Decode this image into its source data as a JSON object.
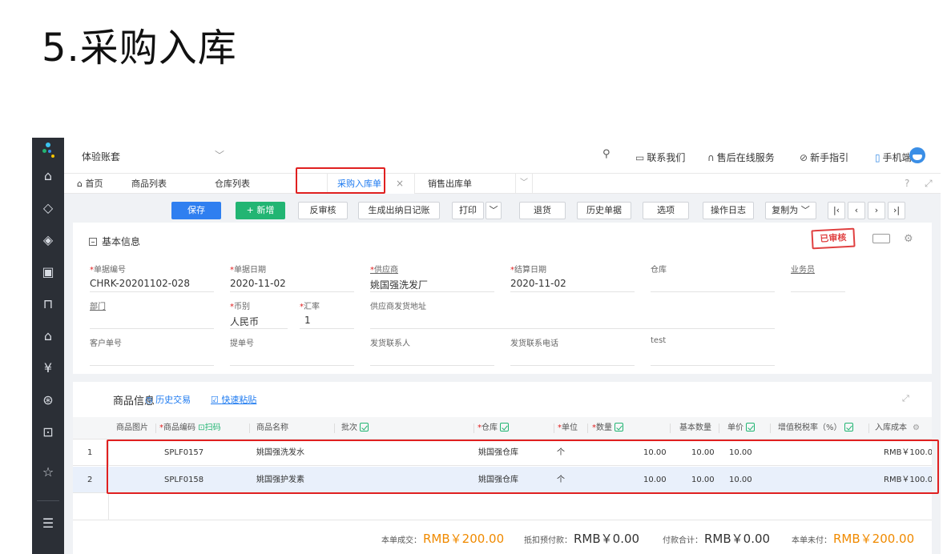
{
  "slide": {
    "title": "5.采购入库"
  },
  "topbar": {
    "account": "体验账套",
    "contact": "联系我们",
    "support": "售后在线服务",
    "guide": "新手指引",
    "mobile": "手机端"
  },
  "tabs": [
    {
      "label": "首页"
    },
    {
      "label": "商品列表"
    },
    {
      "label": "仓库列表"
    },
    {
      "label": "采购入库单",
      "active": true
    },
    {
      "label": "销售出库单"
    }
  ],
  "toolbar": {
    "save": "保存",
    "new": "+ 新增",
    "unaudit": "反审核",
    "journal": "生成出纳日记账",
    "print": "打印",
    "return": "退货",
    "history": "历史单据",
    "options": "选项",
    "oplog": "操作日志",
    "copy_as": "复制为"
  },
  "basic_info": {
    "title": "基本信息",
    "stamp": "已审核",
    "fields": {
      "doc_no": {
        "label": "单据编号",
        "value": "CHRK-20201102-028"
      },
      "doc_date": {
        "label": "单据日期",
        "value": "2020-11-02"
      },
      "supplier": {
        "label": "供应商",
        "value": "姚国强洗发厂"
      },
      "settle_date": {
        "label": "结算日期",
        "value": "2020-11-02"
      },
      "warehouse": {
        "label": "仓库",
        "value": ""
      },
      "salesman": {
        "label": "业务员",
        "value": ""
      },
      "dept": {
        "label": "部门",
        "value": ""
      },
      "currency": {
        "label": "币别",
        "value": "人民币"
      },
      "rate": {
        "label": "汇率",
        "value": "1"
      },
      "ship_addr": {
        "label": "供应商发货地址",
        "value": ""
      },
      "customer_no": {
        "label": "客户单号",
        "value": ""
      },
      "bill_no": {
        "label": "提单号",
        "value": ""
      },
      "ship_contact": {
        "label": "发货联系人",
        "value": ""
      },
      "ship_phone": {
        "label": "发货联系电话",
        "value": ""
      },
      "extra": {
        "label": "test",
        "value": ""
      }
    }
  },
  "products": {
    "title": "商品信息",
    "history_link": "历史交易",
    "paste_link": "快速粘贴",
    "headers": {
      "image": "商品图片",
      "code": "商品编码",
      "scan": "扫码",
      "name": "商品名称",
      "batch": "批次",
      "warehouse": "仓库",
      "unit": "单位",
      "qty": "数量",
      "base_qty": "基本数量",
      "price": "单价",
      "tax_rate": "增值税税率（%）",
      "cost": "入库成本"
    },
    "rows": [
      {
        "no": "1",
        "code": "SPLF0157",
        "name": "姚国强洗发水",
        "warehouse": "姚国强仓库",
        "unit": "个",
        "qty": "10.00",
        "base_qty": "10.00",
        "price": "10.00",
        "cost": "RMB￥100.0"
      },
      {
        "no": "2",
        "code": "SPLF0158",
        "name": "姚国强护发素",
        "warehouse": "姚国强仓库",
        "unit": "个",
        "qty": "10.00",
        "base_qty": "10.00",
        "price": "10.00",
        "cost": "RMB￥100.0"
      }
    ],
    "totals": {
      "deal_label": "本单成交：",
      "deal": "RMB￥200.00",
      "prepay_label": "抵扣预付款：",
      "prepay": "RMB￥0.00",
      "paid_label": "付款合计：",
      "paid": "RMB￥0.00",
      "unpaid_label": "本单未付：",
      "unpaid": "RMB￥200.00"
    }
  },
  "colors": {
    "accent": "#2f7ff0",
    "green": "#22b573",
    "orange": "#f08a00",
    "highlight": "#e02020",
    "sidebar": "#2b2f36"
  }
}
